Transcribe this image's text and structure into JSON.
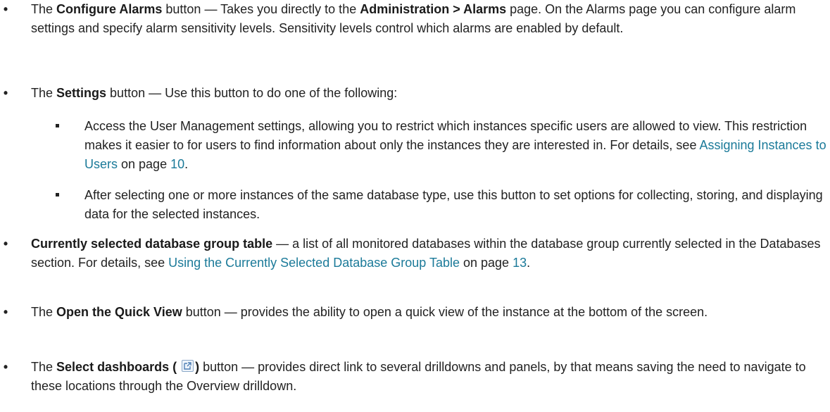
{
  "bullet_glyph": "•",
  "items": [
    {
      "pre": "The ",
      "b1": "Configure Alarms",
      "mid1": " button — Takes you directly to the ",
      "b2": "Administration > Alarms",
      "post": " page. On the Alarms page you can configure alarm settings and specify alarm sensitivity levels. Sensitivity levels control which alarms are enabled by default."
    },
    {
      "pre": "The ",
      "b1": "Settings",
      "post": " button — Use this button to do one of the following:"
    },
    {
      "text": "Access the User Management settings, allowing you to restrict which instances specific users are allowed to view. This restriction makes it easier to for users to find information about only the instances they are interested in. For details, see ",
      "link": "Assigning Instances to Users",
      "mid": " on page ",
      "page": "10",
      "end": "."
    },
    {
      "text": "After selecting one or more instances of the same database type, use this button to set options for collecting, storing, and displaying data for the selected instances."
    },
    {
      "b1": "Currently selected database group table",
      "post": " — a list of all monitored databases within the database group currently selected in the Databases section. For details, see ",
      "link": "Using the Currently Selected Database Group Table",
      "mid": " on page ",
      "page": "13",
      "end": "."
    },
    {
      "pre": "The ",
      "b1": "Open the Quick View",
      "post": " button — provides the ability to open a quick view of the instance at the bottom of the screen."
    },
    {
      "pre": "The ",
      "b1": "Select dashboards (",
      "b1_close": ")",
      "post": " button — provides direct link to several drilldowns and panels, by that means saving the need to navigate to these locations through the Overview drilldown.",
      "icon": "external-link-icon"
    }
  ]
}
